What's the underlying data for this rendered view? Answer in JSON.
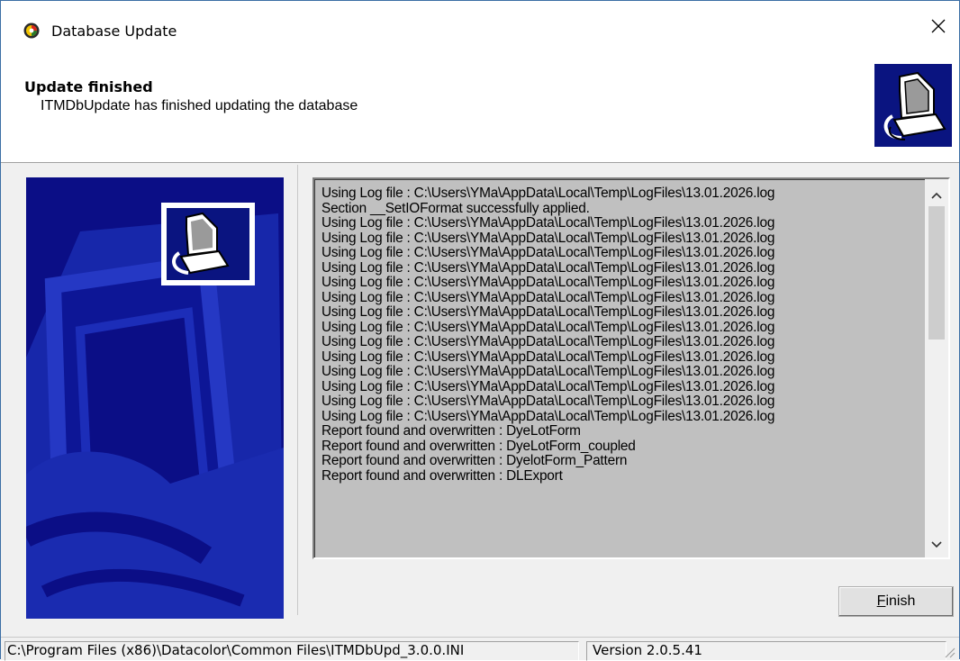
{
  "window": {
    "title": "Database Update",
    "icons": {
      "app": "datacolor-app-icon",
      "close": "close-icon"
    }
  },
  "header": {
    "title": "Update finished",
    "subtitle": "ITMDbUpdate has finished updating the database",
    "icon": "computer-database-icon"
  },
  "colors": {
    "art_background": "#0b0e86",
    "art_shape": "#1a2bb0",
    "log_background": "#c0c0c0"
  },
  "log": {
    "lines": [
      "Using Log file : C:\\Users\\YMa\\AppData\\Local\\Temp\\LogFiles\\13.01.2026.log",
      "Section __SetIOFormat successfully applied.",
      "Using Log file : C:\\Users\\YMa\\AppData\\Local\\Temp\\LogFiles\\13.01.2026.log",
      "Using Log file : C:\\Users\\YMa\\AppData\\Local\\Temp\\LogFiles\\13.01.2026.log",
      "Using Log file : C:\\Users\\YMa\\AppData\\Local\\Temp\\LogFiles\\13.01.2026.log",
      "Using Log file : C:\\Users\\YMa\\AppData\\Local\\Temp\\LogFiles\\13.01.2026.log",
      "Using Log file : C:\\Users\\YMa\\AppData\\Local\\Temp\\LogFiles\\13.01.2026.log",
      "Using Log file : C:\\Users\\YMa\\AppData\\Local\\Temp\\LogFiles\\13.01.2026.log",
      "Using Log file : C:\\Users\\YMa\\AppData\\Local\\Temp\\LogFiles\\13.01.2026.log",
      "Using Log file : C:\\Users\\YMa\\AppData\\Local\\Temp\\LogFiles\\13.01.2026.log",
      "Using Log file : C:\\Users\\YMa\\AppData\\Local\\Temp\\LogFiles\\13.01.2026.log",
      "Using Log file : C:\\Users\\YMa\\AppData\\Local\\Temp\\LogFiles\\13.01.2026.log",
      "Using Log file : C:\\Users\\YMa\\AppData\\Local\\Temp\\LogFiles\\13.01.2026.log",
      "Using Log file : C:\\Users\\YMa\\AppData\\Local\\Temp\\LogFiles\\13.01.2026.log",
      "Using Log file : C:\\Users\\YMa\\AppData\\Local\\Temp\\LogFiles\\13.01.2026.log",
      "Using Log file : C:\\Users\\YMa\\AppData\\Local\\Temp\\LogFiles\\13.01.2026.log",
      "Report found and overwritten : DyeLotForm",
      "Report found and overwritten : DyeLotForm_coupled",
      "Report found and overwritten : DyelotForm_Pattern",
      "Report found and overwritten : DLExport"
    ],
    "scroll_icons": {
      "up": "chevron-up-icon",
      "down": "chevron-down-icon"
    }
  },
  "buttons": {
    "finish_accel": "F",
    "finish_rest": "inish"
  },
  "statusbar": {
    "ini_path": "C:\\Program Files (x86)\\Datacolor\\Common Files\\ITMDbUpd_3.0.0.INI",
    "version": "Version 2.0.5.41"
  }
}
